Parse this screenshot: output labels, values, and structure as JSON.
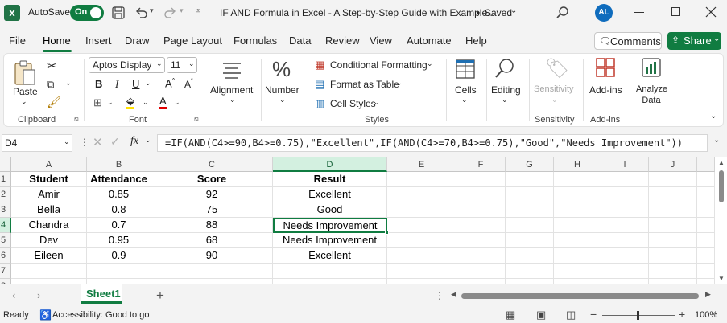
{
  "titlebar": {
    "autosave_label": "AutoSave",
    "autosave_state": "On",
    "document_title": "IF AND Formula in Excel - A Step-by-Step Guide with Example...",
    "save_status": "Saved",
    "avatar_initials": "AL"
  },
  "menu": {
    "items": [
      "File",
      "Home",
      "Insert",
      "Draw",
      "Page Layout",
      "Formulas",
      "Data",
      "Review",
      "View",
      "Automate",
      "Help"
    ],
    "active": "Home",
    "comments_label": "Comments",
    "share_label": "Share"
  },
  "ribbon": {
    "clipboard": {
      "paste_label": "Paste",
      "group_label": "Clipboard"
    },
    "font": {
      "font_name": "Aptos Display",
      "font_size": "11",
      "group_label": "Font"
    },
    "alignment_label": "Alignment",
    "number_label": "Number",
    "styles": {
      "conditional_formatting": "Conditional Formatting",
      "format_as_table": "Format as Table",
      "cell_styles": "Cell Styles",
      "group_label": "Styles"
    },
    "cells_label": "Cells",
    "editing_label": "Editing",
    "sensitivity": {
      "button_label": "Sensitivity",
      "group_label": "Sensitivity"
    },
    "addins": {
      "button_label": "Add-ins",
      "group_label": "Add-ins"
    },
    "analyze": {
      "line1": "Analyze",
      "line2": "Data"
    }
  },
  "formula_bar": {
    "name_box": "D4",
    "fx_label": "fx",
    "formula": "=IF(AND(C4>=90,B4>=0.75),\"Excellent\",IF(AND(C4>=70,B4>=0.75),\"Good\",\"Needs Improvement\"))"
  },
  "grid": {
    "columns": [
      "A",
      "B",
      "C",
      "D",
      "E",
      "F",
      "G",
      "H",
      "I",
      "J"
    ],
    "row_numbers": [
      "1",
      "2",
      "3",
      "4",
      "5",
      "6",
      "7",
      "8"
    ],
    "header_row": [
      "Student",
      "Attendance",
      "Score",
      "Result"
    ],
    "rows": [
      [
        "Amir",
        "0.85",
        "92",
        "Excellent"
      ],
      [
        "Bella",
        "0.8",
        "75",
        "Good"
      ],
      [
        "Chandra",
        "0.7",
        "88",
        "Needs Improvement"
      ],
      [
        "Dev",
        "0.95",
        "68",
        "Needs Improvement"
      ],
      [
        "Eileen",
        "0.9",
        "90",
        "Excellent"
      ]
    ],
    "selected_cell": "D4"
  },
  "sheets": {
    "tabs": [
      "Sheet1"
    ],
    "active": "Sheet1"
  },
  "status": {
    "ready": "Ready",
    "accessibility": "Accessibility: Good to go",
    "zoom": "100%"
  },
  "colors": {
    "excel_green": "#217346",
    "accent_green": "#107c41",
    "avatar_blue": "#0f6cbd"
  }
}
